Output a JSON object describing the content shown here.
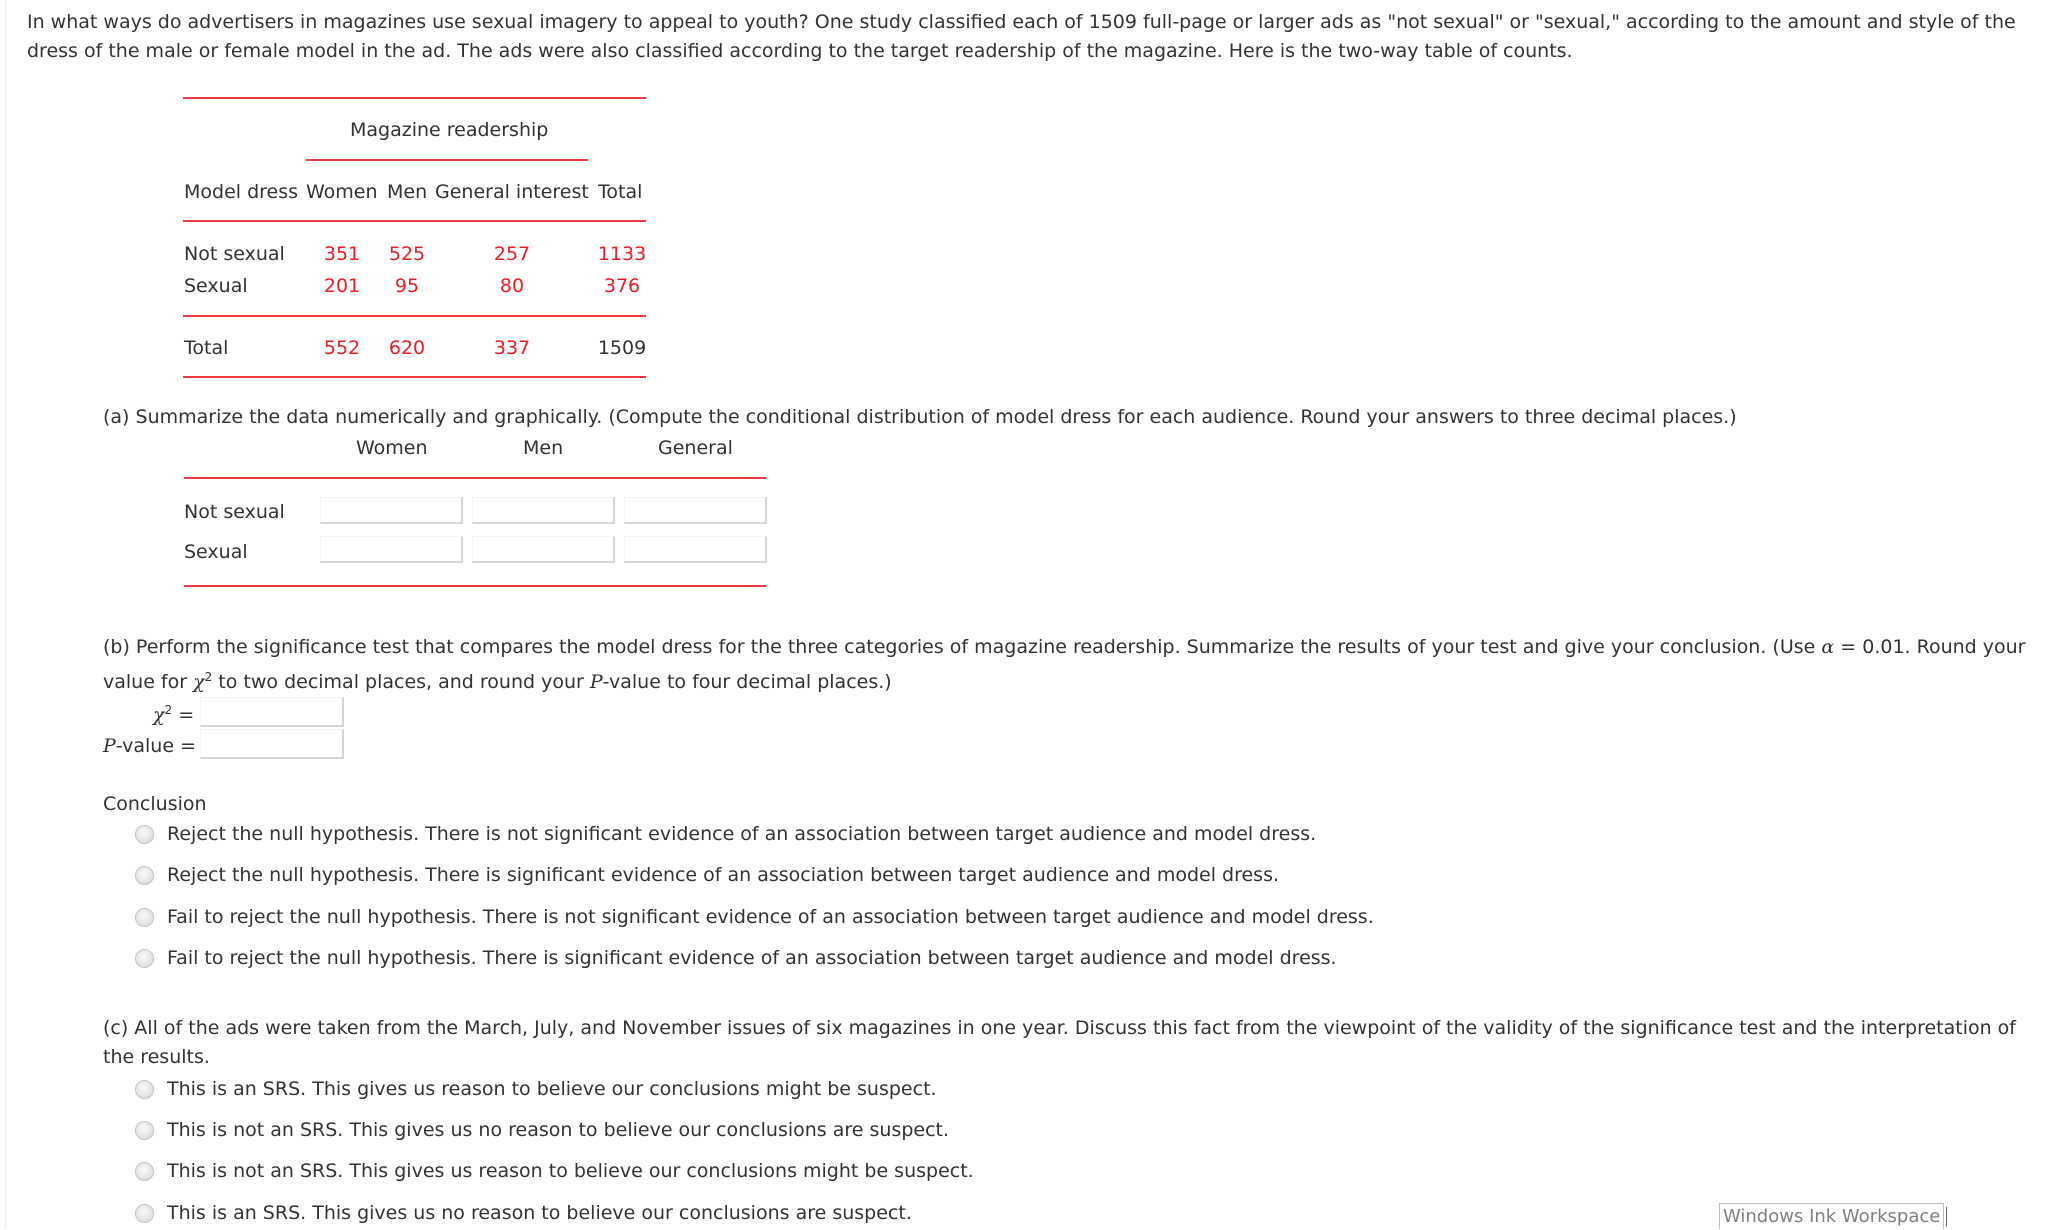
{
  "intro_text": "In what ways do advertisers in magazines use sexual imagery to appeal to youth? One study classified each of 1509 full-page or larger ads as \"not sexual\" or \"sexual,\" according to the amount and style of the dress of the male or female model in the ad. The ads were also classified according to the target readership of the magazine. Here is the two-way table of counts.",
  "counts_table": {
    "group_header": "Magazine readership",
    "columns": [
      "Model dress",
      "Women",
      "Men",
      "General interest",
      "Total"
    ],
    "rows": [
      {
        "label": "Not sexual",
        "values": [
          "351",
          "525",
          "257",
          "1133"
        ]
      },
      {
        "label": "Sexual",
        "values": [
          "201",
          "95",
          "80",
          "376"
        ]
      }
    ],
    "total_row": {
      "label": "Total",
      "values": [
        "552",
        "620",
        "337",
        "1509"
      ]
    }
  },
  "part_a": {
    "prompt": "(a) Summarize the data numerically and graphically. (Compute the conditional distribution of model dress for each audience. Round your answers to three decimal places.)",
    "columns": [
      "Women",
      "Men",
      "General"
    ],
    "rows": [
      {
        "label": "Not sexual",
        "values": [
          "",
          "",
          ""
        ]
      },
      {
        "label": "Sexual",
        "values": [
          "",
          "",
          ""
        ]
      }
    ]
  },
  "part_b": {
    "prompt_line1": "(b) Perform the significance test that compares the model dress for the three categories of magazine readership. Summarize the results of your test and give your conclusion. (Use ",
    "alpha_symbol": "α",
    "alpha_value": " = 0.01. Round your",
    "prompt_line2_a": "value for ",
    "chi_symbol": "χ",
    "chi_exp": "2",
    "prompt_line2_b": " to two decimal places, and round your ",
    "p_italic": "P",
    "prompt_line2_c": "-value to four decimal places.)",
    "chi_label_eq": " =",
    "pvalue_label_rest": "-value =",
    "chi_value": "",
    "p_value": "",
    "conclusion_label": "Conclusion",
    "options": [
      "Reject the null hypothesis. There is not significant evidence of an association between target audience and model dress.",
      "Reject the null hypothesis. There is significant evidence of an association between target audience and model dress.",
      "Fail to reject the null hypothesis. There is not significant evidence of an association between target audience and model dress.",
      "Fail to reject the null hypothesis. There is significant evidence of an association between target audience and model dress."
    ]
  },
  "part_c": {
    "prompt": "(c) All of the ads were taken from the March, July, and November issues of six magazines in one year. Discuss this fact from the viewpoint of the validity of the significance test and the interpretation of the results.",
    "options": [
      "This is an SRS. This gives us reason to believe our conclusions might be suspect.",
      "This is not an SRS. This gives us no reason to believe our conclusions are suspect.",
      "This is not an SRS. This gives us reason to believe our conclusions might be suspect.",
      "This is an SRS. This gives us no reason to believe our conclusions are suspect."
    ]
  },
  "taskbar_label": "Windows Ink Workspace",
  "colors": {
    "data_value": "#ee1c24",
    "rule": "#ee3b42",
    "text": "#333333"
  }
}
